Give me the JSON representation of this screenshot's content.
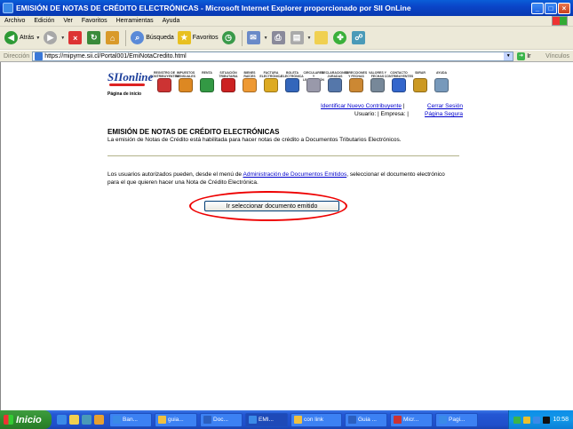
{
  "window": {
    "title": "EMISIÓN DE NOTAS DE CRÉDITO ELECTRÓNICAS - Microsoft Internet Explorer proporcionado por SII OnLine",
    "min_label": "_",
    "max_label": "□",
    "close_label": "×"
  },
  "menu": [
    "Archivo",
    "Edición",
    "Ver",
    "Favoritos",
    "Herramientas",
    "Ayuda"
  ],
  "toolbar": {
    "back_label": "Atrás",
    "search_label": "Búsqueda",
    "favorites_label": "Favoritos"
  },
  "address": {
    "label": "Dirección",
    "url": "https://mipyme.sii.cl/Portal001/EmiNotaCredito.html",
    "go_label": "Ir",
    "links_label": "Vínculos"
  },
  "site": {
    "logo_text": "SIIonline",
    "logo_sub": "Página de inicio",
    "strip": [
      {
        "label": "REGISTRO DE CONTRIBUYENTES",
        "color": "#cc3333"
      },
      {
        "label": "IMPUESTOS MENSUALES",
        "color": "#dd8822"
      },
      {
        "label": "RENTA",
        "color": "#339944"
      },
      {
        "label": "SITUACIÓN TRIBUTARIA",
        "color": "#cc2222"
      },
      {
        "label": "BIENES RAÍCES",
        "color": "#ee9933"
      },
      {
        "label": "FACTURA ELECTRÓNICA",
        "color": "#ddaa22"
      },
      {
        "label": "BOLETA ELECTRÓNICA",
        "color": "#3366bb"
      },
      {
        "label": "CIRCULARES Y LEGISLACIÓN",
        "color": "#9999aa"
      },
      {
        "label": "DECLARACIONES JURADAS",
        "color": "#5577aa"
      },
      {
        "label": "DIRECCIONES Y FECHAS",
        "color": "#cc8833"
      },
      {
        "label": "VALORES Y FECHAS",
        "color": "#778899"
      },
      {
        "label": "CONTACTO CONTRIBUYENTES",
        "color": "#3366cc"
      },
      {
        "label": "SIIRAR",
        "color": "#cc9922"
      },
      {
        "label": "AYUDA",
        "color": "#7799bb"
      }
    ],
    "links": {
      "new_taxpayer": "Identificar Nuevo Contribuyente",
      "logout": "Cerrar Sesión",
      "user_label": "Usuario:",
      "company_label": "Empresa:",
      "secure_page": "Página Segura",
      "pipe": "|"
    },
    "title": "EMISIÓN DE NOTAS DE CRÉDITO ELECTRÓNICAS",
    "subtitle": "La emisión de Notas de Crédito está habilitada para hacer notas de crédito a Documentos Tributarios Electrónicos.",
    "body_pre": "Los usuarios autorizados pueden, desde el menú de ",
    "body_link": "Administración de Documentos Emitidos",
    "body_post": ", seleccionar el documento electrónico para el que quieren hacer una Nota de Crédito Electrónica.",
    "button_label": "Ir seleccionar documento emitido"
  },
  "taskbar": {
    "start_label": "Inicio",
    "tasks": [
      {
        "label": "Ban...",
        "color": "#3a8ae8",
        "active": false
      },
      {
        "label": "guia...",
        "color": "#f0c040",
        "active": false
      },
      {
        "label": "Doc...",
        "color": "#2b5fbf",
        "active": false
      },
      {
        "label": "EMI...",
        "color": "#3a8ae8",
        "active": true
      },
      {
        "label": "con link",
        "color": "#f0c040",
        "active": false
      },
      {
        "label": "Guia ...",
        "color": "#2b5fbf",
        "active": false
      },
      {
        "label": "Micr...",
        "color": "#c33",
        "active": false
      },
      {
        "label": "Pagi...",
        "color": "#3a8ae8",
        "active": false
      }
    ],
    "clock": "10:58"
  }
}
